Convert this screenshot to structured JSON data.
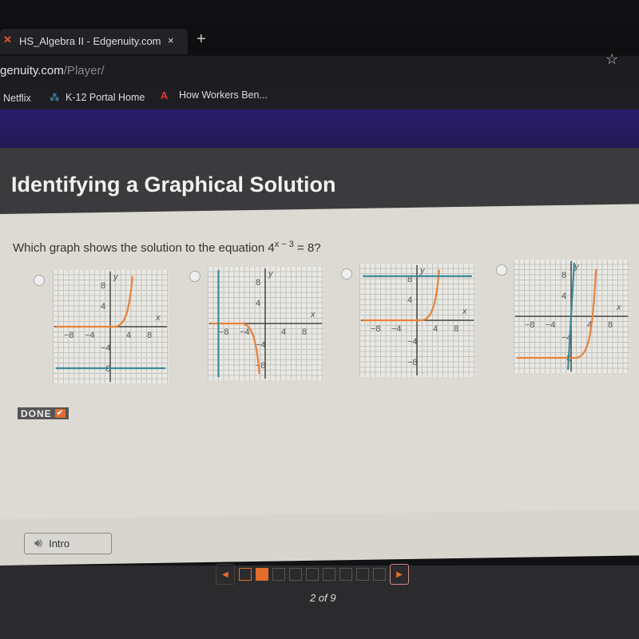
{
  "browser": {
    "tab_title": "HS_Algebra II - Edgenuity.com",
    "tab_close": "×",
    "new_tab": "+",
    "url_host": "genuity.com",
    "url_path": "/Player/",
    "star": "☆",
    "bookmarks": [
      {
        "label": "Netflix"
      },
      {
        "label": "K-12 Portal Home"
      },
      {
        "label": "How Workers Ben..."
      }
    ]
  },
  "page": {
    "title": "Identifying a Graphical Solution",
    "question_prefix": "Which graph shows the solution to the equation 4",
    "question_exponent": "x − 3",
    "question_suffix": " = 8?",
    "options": [
      {
        "ticks_x": [
          "−8",
          "−4",
          "4",
          "8"
        ],
        "ticks_y": [
          "8",
          "4",
          "−4",
          "−8"
        ],
        "x_label": "x",
        "y_label": "y"
      },
      {
        "ticks_x": [
          "−8",
          "−4",
          "4",
          "8"
        ],
        "ticks_y": [
          "8",
          "4",
          "−4",
          "−8"
        ],
        "x_label": "x",
        "y_label": "y"
      },
      {
        "ticks_x": [
          "−8",
          "−4",
          "4",
          "8"
        ],
        "ticks_y": [
          "8",
          "4",
          "−4",
          "−8"
        ],
        "x_label": "x",
        "y_label": "y"
      },
      {
        "ticks_x": [
          "−8",
          "−4",
          "4",
          "8"
        ],
        "ticks_y": [
          "8",
          "4",
          "−4",
          "−8"
        ],
        "x_label": "x",
        "y_label": "y"
      }
    ],
    "done_label": "DONE",
    "done_check": "✔",
    "intro_label": "Intro",
    "pager": {
      "current": 2,
      "total": 9,
      "text": "2 of 9"
    },
    "colors": {
      "curve": "#e8823a",
      "line": "#3d8a9a",
      "accent": "#e36b2c"
    }
  }
}
